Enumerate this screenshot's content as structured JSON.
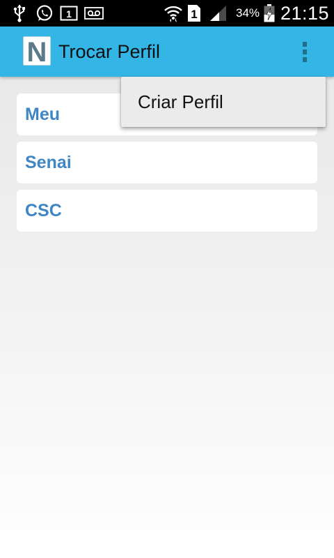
{
  "status_bar": {
    "icons": [
      "usb-icon",
      "whatsapp-icon",
      "sim-notification-icon",
      "voicemail-icon",
      "wifi-icon",
      "sim1-icon",
      "signal-icon",
      "battery-charging-icon"
    ],
    "battery_percent": "34%",
    "sim_label": "1",
    "notification_label": "1",
    "time": "21:15"
  },
  "action_bar": {
    "app_icon_letter": "N",
    "title": "Trocar Perfil",
    "background_color": "#33b5e5"
  },
  "profiles": [
    {
      "label": "Meu"
    },
    {
      "label": "Senai"
    },
    {
      "label": "CSC"
    }
  ],
  "overflow_menu": {
    "items": [
      {
        "label": "Criar Perfil"
      }
    ]
  },
  "colors": {
    "accent": "#33b5e5",
    "profile_text": "#3f86c4",
    "overflow_dots": "#236e8d"
  }
}
